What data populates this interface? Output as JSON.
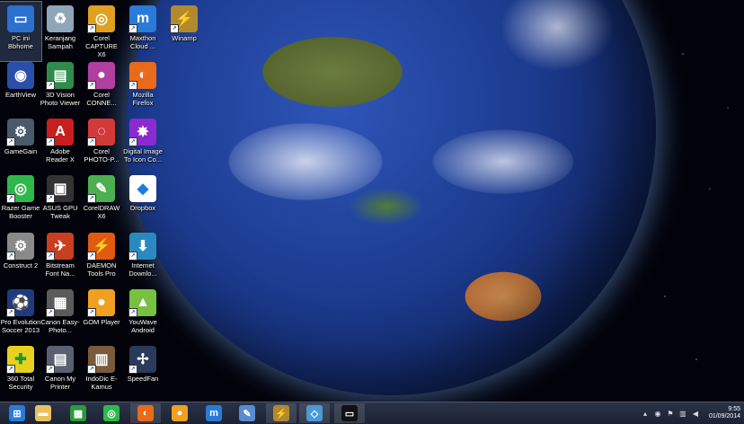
{
  "desktop_icons": [
    {
      "name": "pc-ini-bbhome",
      "label": "PC ini Bbhome",
      "icon": "computer-icon",
      "color": "#2b6fcf",
      "glyph": "▭",
      "shortcut": false,
      "selected": true
    },
    {
      "name": "keranjang-sampah",
      "label": "Keranjang Sampah",
      "icon": "recycle-bin-icon",
      "color": "#8fa6b8",
      "glyph": "♻",
      "shortcut": false
    },
    {
      "name": "corel-capture",
      "label": "Corel CAPTURE X6",
      "icon": "corel-capture-icon",
      "color": "#e0a020",
      "glyph": "◎",
      "shortcut": true
    },
    {
      "name": "maxthon",
      "label": "Maxthon Cloud ...",
      "icon": "maxthon-icon",
      "color": "#2a7ad8",
      "glyph": "m",
      "shortcut": true
    },
    {
      "name": "winamp",
      "label": "Winamp",
      "icon": "winamp-icon",
      "color": "#b08a2c",
      "glyph": "⚡",
      "shortcut": true
    },
    {
      "name": "earthview",
      "label": "EarthView",
      "icon": "earthview-icon",
      "color": "#2a4fa8",
      "glyph": "◉",
      "shortcut": false
    },
    {
      "name": "3d-vision",
      "label": "3D Vision Photo Viewer",
      "icon": "3d-vision-icon",
      "color": "#2f8c4a",
      "glyph": "▤",
      "shortcut": true
    },
    {
      "name": "corel-connect",
      "label": "Corel CONNE...",
      "icon": "corel-connect-icon",
      "color": "#b03fa0",
      "glyph": "●",
      "shortcut": true
    },
    {
      "name": "mozilla-firefox",
      "label": "Mozilla Firefox",
      "icon": "firefox-icon",
      "color": "#e86a1a",
      "glyph": "◐",
      "shortcut": true
    },
    {
      "name": "gamegain",
      "label": "GameGain",
      "icon": "gamegain-icon",
      "color": "#4a5a6a",
      "glyph": "⚙",
      "shortcut": true
    },
    {
      "name": "adobe-reader",
      "label": "Adobe Reader X",
      "icon": "adobe-reader-icon",
      "color": "#c81e1e",
      "glyph": "A",
      "shortcut": true
    },
    {
      "name": "corel-photo-paint",
      "label": "Corel PHOTO-P...",
      "icon": "corel-photo-paint-icon",
      "color": "#d23a3a",
      "glyph": "◌",
      "shortcut": true
    },
    {
      "name": "digital-image",
      "label": "Digital Image To Icon Co...",
      "icon": "digital-image-icon",
      "color": "#8a2ad0",
      "glyph": "✸",
      "shortcut": true
    },
    {
      "name": "razer-game-booster",
      "label": "Razer Game Booster",
      "icon": "razer-icon",
      "color": "#2fb84a",
      "glyph": "◎",
      "shortcut": true
    },
    {
      "name": "asus-gpu-tweak",
      "label": "ASUS GPU Tweak",
      "icon": "asus-gpu-icon",
      "color": "#333",
      "glyph": "▣",
      "shortcut": true
    },
    {
      "name": "coreldraw",
      "label": "CorelDRAW X6",
      "icon": "coreldraw-icon",
      "color": "#4caf50",
      "glyph": "✎",
      "shortcut": true
    },
    {
      "name": "dropbox",
      "label": "Dropbox",
      "icon": "dropbox-icon",
      "color": "#ffffff",
      "glyph": "◆",
      "shortcut": false,
      "fg": "#1a7ce0"
    },
    {
      "name": "construct-2",
      "label": "Construct 2",
      "icon": "construct-icon",
      "color": "#8a8a8a",
      "glyph": "⚙",
      "shortcut": true
    },
    {
      "name": "bitstream-font",
      "label": "Bitstream Font Na...",
      "icon": "bitstream-icon",
      "color": "#c84020",
      "glyph": "✈",
      "shortcut": true
    },
    {
      "name": "daemon-tools",
      "label": "DAEMON Tools Pro",
      "icon": "daemon-tools-icon",
      "color": "#e05a10",
      "glyph": "⚡",
      "shortcut": true
    },
    {
      "name": "internet-download",
      "label": "Internet Downlo...",
      "icon": "idm-icon",
      "color": "#2a8ac0",
      "glyph": "⬇",
      "shortcut": true
    },
    {
      "name": "pro-evolution",
      "label": "Pro Evolution Soccer 2013",
      "icon": "pes-icon",
      "color": "#203a80",
      "glyph": "⚽",
      "shortcut": true
    },
    {
      "name": "canon-easy-photo",
      "label": "Canon Easy-Photo...",
      "icon": "canon-printer-icon",
      "color": "#5a5a5a",
      "glyph": "▦",
      "shortcut": true
    },
    {
      "name": "gom-player",
      "label": "GOM Player",
      "icon": "gom-player-icon",
      "color": "#f0a020",
      "glyph": "●",
      "shortcut": true
    },
    {
      "name": "youwave",
      "label": "YouWave Android",
      "icon": "android-icon",
      "color": "#78c040",
      "glyph": "▲",
      "shortcut": true
    },
    {
      "name": "360-total-security",
      "label": "360 Total Security",
      "icon": "360-security-icon",
      "color": "#e8d020",
      "glyph": "✚",
      "shortcut": true,
      "fg": "#1a9a2a"
    },
    {
      "name": "canon-my-printer",
      "label": "Canon My Printer",
      "icon": "canon-my-printer-icon",
      "color": "#5a6070",
      "glyph": "▤",
      "shortcut": true
    },
    {
      "name": "indodic",
      "label": "IndoDic E-Kamus",
      "icon": "indodic-icon",
      "color": "#7a5a3a",
      "glyph": "▥",
      "shortcut": true
    },
    {
      "name": "speedfan",
      "label": "SpeedFan",
      "icon": "speedfan-icon",
      "color": "#2a3a5a",
      "glyph": "✢",
      "shortcut": true
    }
  ],
  "taskbar": {
    "items": [
      {
        "name": "start-button",
        "icon": "windows-start-icon",
        "color": "#2a7ad8",
        "glyph": "⊞"
      },
      {
        "name": "taskbar-file-explorer",
        "icon": "folder-icon",
        "color": "#e8c060",
        "glyph": "▬"
      },
      {
        "name": "taskbar-store",
        "icon": "store-icon",
        "color": "#2a9a3a",
        "glyph": "▦"
      },
      {
        "name": "taskbar-razer",
        "icon": "razer-icon",
        "color": "#2fb84a",
        "glyph": "◎"
      },
      {
        "name": "taskbar-firefox",
        "icon": "firefox-icon",
        "color": "#e86a1a",
        "glyph": "◐",
        "active": true
      },
      {
        "name": "taskbar-gom",
        "icon": "gom-player-icon",
        "color": "#f0a020",
        "glyph": "●"
      },
      {
        "name": "taskbar-maxthon",
        "icon": "maxthon-icon",
        "color": "#2a7ad8",
        "glyph": "m"
      },
      {
        "name": "taskbar-paint",
        "icon": "paint-icon",
        "color": "#5a8ad0",
        "glyph": "✎"
      },
      {
        "name": "taskbar-winamp",
        "icon": "winamp-icon",
        "color": "#b08a2c",
        "glyph": "⚡",
        "active": true
      },
      {
        "name": "taskbar-app",
        "icon": "blue-window-icon",
        "color": "#4a9ad8",
        "glyph": "◇",
        "active": true
      },
      {
        "name": "taskbar-cmd",
        "icon": "console-icon",
        "color": "#111",
        "glyph": "▭",
        "active": true
      }
    ],
    "tray": {
      "icons": [
        {
          "name": "tray-chevron",
          "icon": "chevron-up-icon",
          "glyph": "▴"
        },
        {
          "name": "tray-app",
          "icon": "app-tray-icon",
          "glyph": "◉"
        },
        {
          "name": "tray-flag",
          "icon": "flag-icon",
          "glyph": "⚑"
        },
        {
          "name": "tray-network",
          "icon": "network-icon",
          "glyph": "▥"
        },
        {
          "name": "tray-volume",
          "icon": "volume-icon",
          "glyph": "◀"
        }
      ],
      "time": "9:55",
      "date": "01/09/2014"
    }
  }
}
